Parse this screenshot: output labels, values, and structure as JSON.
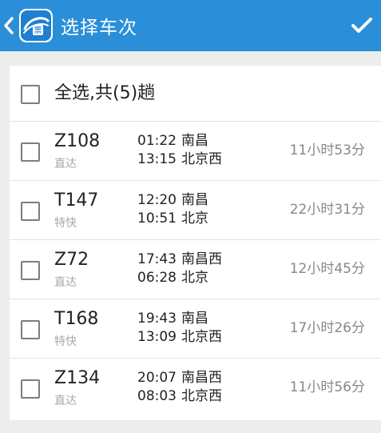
{
  "header": {
    "title": "选择车次",
    "back_icon": "chevron-left-icon",
    "app_icon": "train-ticket-app-icon",
    "app_icon_text": "票",
    "confirm_icon": "checkmark-icon",
    "bar_color": "#2a8fd8"
  },
  "select_all": {
    "label": "全选,共(5)趟",
    "checked": false
  },
  "trains": [
    {
      "number": "Z108",
      "type": "直达",
      "depart_time": "01:22",
      "depart_station": "南昌",
      "arrive_time": "13:15",
      "arrive_station": "北京西",
      "duration": "11小时53分",
      "checked": false
    },
    {
      "number": "T147",
      "type": "特快",
      "depart_time": "12:20",
      "depart_station": "南昌",
      "arrive_time": "10:51",
      "arrive_station": "北京",
      "duration": "22小时31分",
      "checked": false
    },
    {
      "number": "Z72",
      "type": "直达",
      "depart_time": "17:43",
      "depart_station": "南昌西",
      "arrive_time": "06:28",
      "arrive_station": "北京",
      "duration": "12小时45分",
      "checked": false
    },
    {
      "number": "T168",
      "type": "特快",
      "depart_time": "19:43",
      "depart_station": "南昌",
      "arrive_time": "13:09",
      "arrive_station": "北京西",
      "duration": "17小时26分",
      "checked": false
    },
    {
      "number": "Z134",
      "type": "直达",
      "depart_time": "20:07",
      "depart_station": "南昌西",
      "arrive_time": "08:03",
      "arrive_station": "北京西",
      "duration": "11小时56分",
      "checked": false
    }
  ]
}
